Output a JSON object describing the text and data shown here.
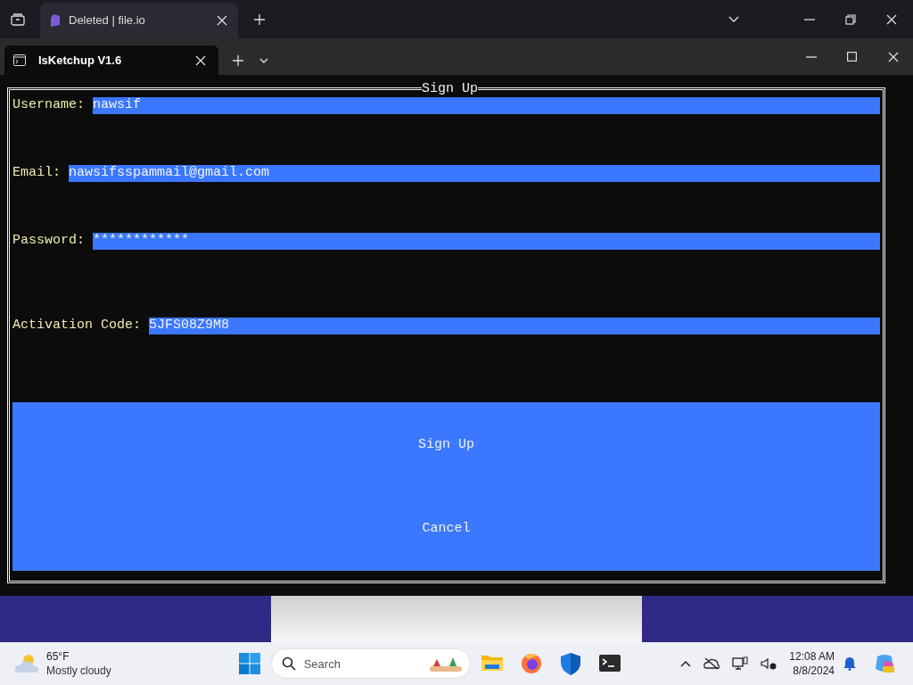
{
  "browser": {
    "tabs": [
      {
        "title": "Deleted | file.io",
        "selected": true
      }
    ]
  },
  "terminal": {
    "tabs": [
      {
        "title": "IsKetchup V1.6",
        "selected": true
      }
    ]
  },
  "form": {
    "title": "Sign Up",
    "fields": [
      {
        "label": "Username:",
        "value": "nawsif"
      },
      {
        "label": "Email:",
        "value": "nawsifsspammail@gmail.com"
      },
      {
        "label": "Password:",
        "value": "************"
      },
      {
        "label": "Activation Code:",
        "value": "5JFS08Z9M8"
      }
    ],
    "buttons": [
      "Sign Up",
      "Cancel"
    ]
  },
  "taskbar": {
    "weather": {
      "temperature": "65°F",
      "condition": "Mostly cloudy"
    },
    "search": {
      "placeholder": "Search"
    },
    "clock": {
      "time": "12:08 AM",
      "date": "8/8/2024"
    }
  }
}
